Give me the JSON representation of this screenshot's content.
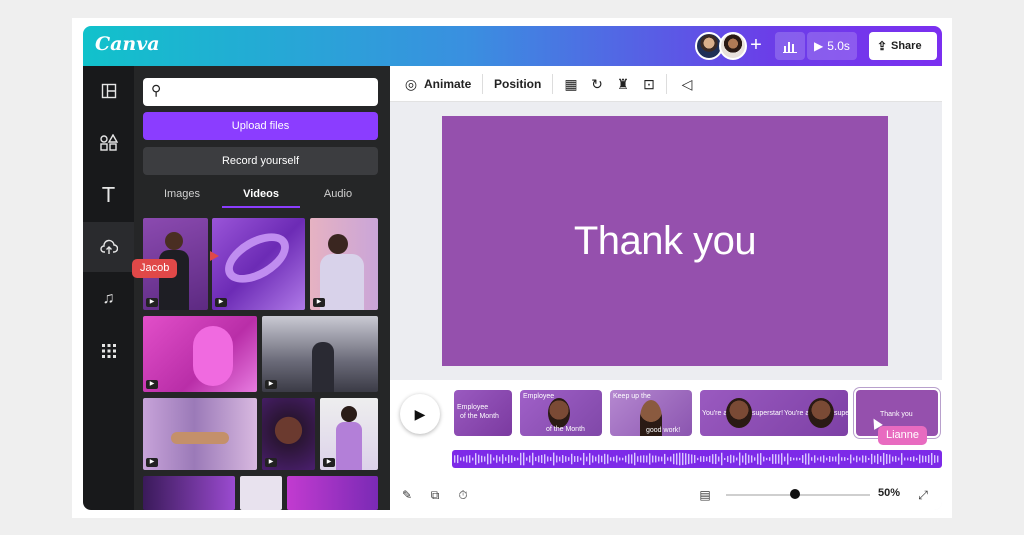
{
  "app": {
    "logo_text": "Canva"
  },
  "topbar": {
    "play_label": "5.0s",
    "share_label": "Share"
  },
  "panel": {
    "search_placeholder": "",
    "upload_label": "Upload files",
    "record_label": "Record yourself",
    "tabs": [
      {
        "label": "Images",
        "active": false
      },
      {
        "label": "Videos",
        "active": true
      },
      {
        "label": "Audio",
        "active": false
      }
    ]
  },
  "toolbar": {
    "animate_label": "Animate",
    "position_label": "Position"
  },
  "canvas": {
    "text": "Thank you",
    "background": "#9550ad"
  },
  "timeline": {
    "clips": [
      {
        "lines": [
          "Employee",
          "of the Month"
        ]
      },
      {
        "lines": [
          "Employee",
          "of the Month"
        ]
      },
      {
        "lines": [
          "Keep up the",
          "good work!"
        ]
      },
      {
        "lines": [
          "You're a",
          "superstar!",
          "You're a",
          "super"
        ]
      },
      {
        "lines": [
          "Thank you"
        ]
      }
    ],
    "zoom": "50%",
    "zoom_fraction": 0.48
  },
  "collaborators": [
    {
      "name": "Jacob",
      "color": "#e04848"
    },
    {
      "name": "Lianne",
      "color": "#e86bc0"
    }
  ],
  "colors": {
    "accent": "#8b3dff",
    "panel": "#252627",
    "rail": "#18191b"
  }
}
